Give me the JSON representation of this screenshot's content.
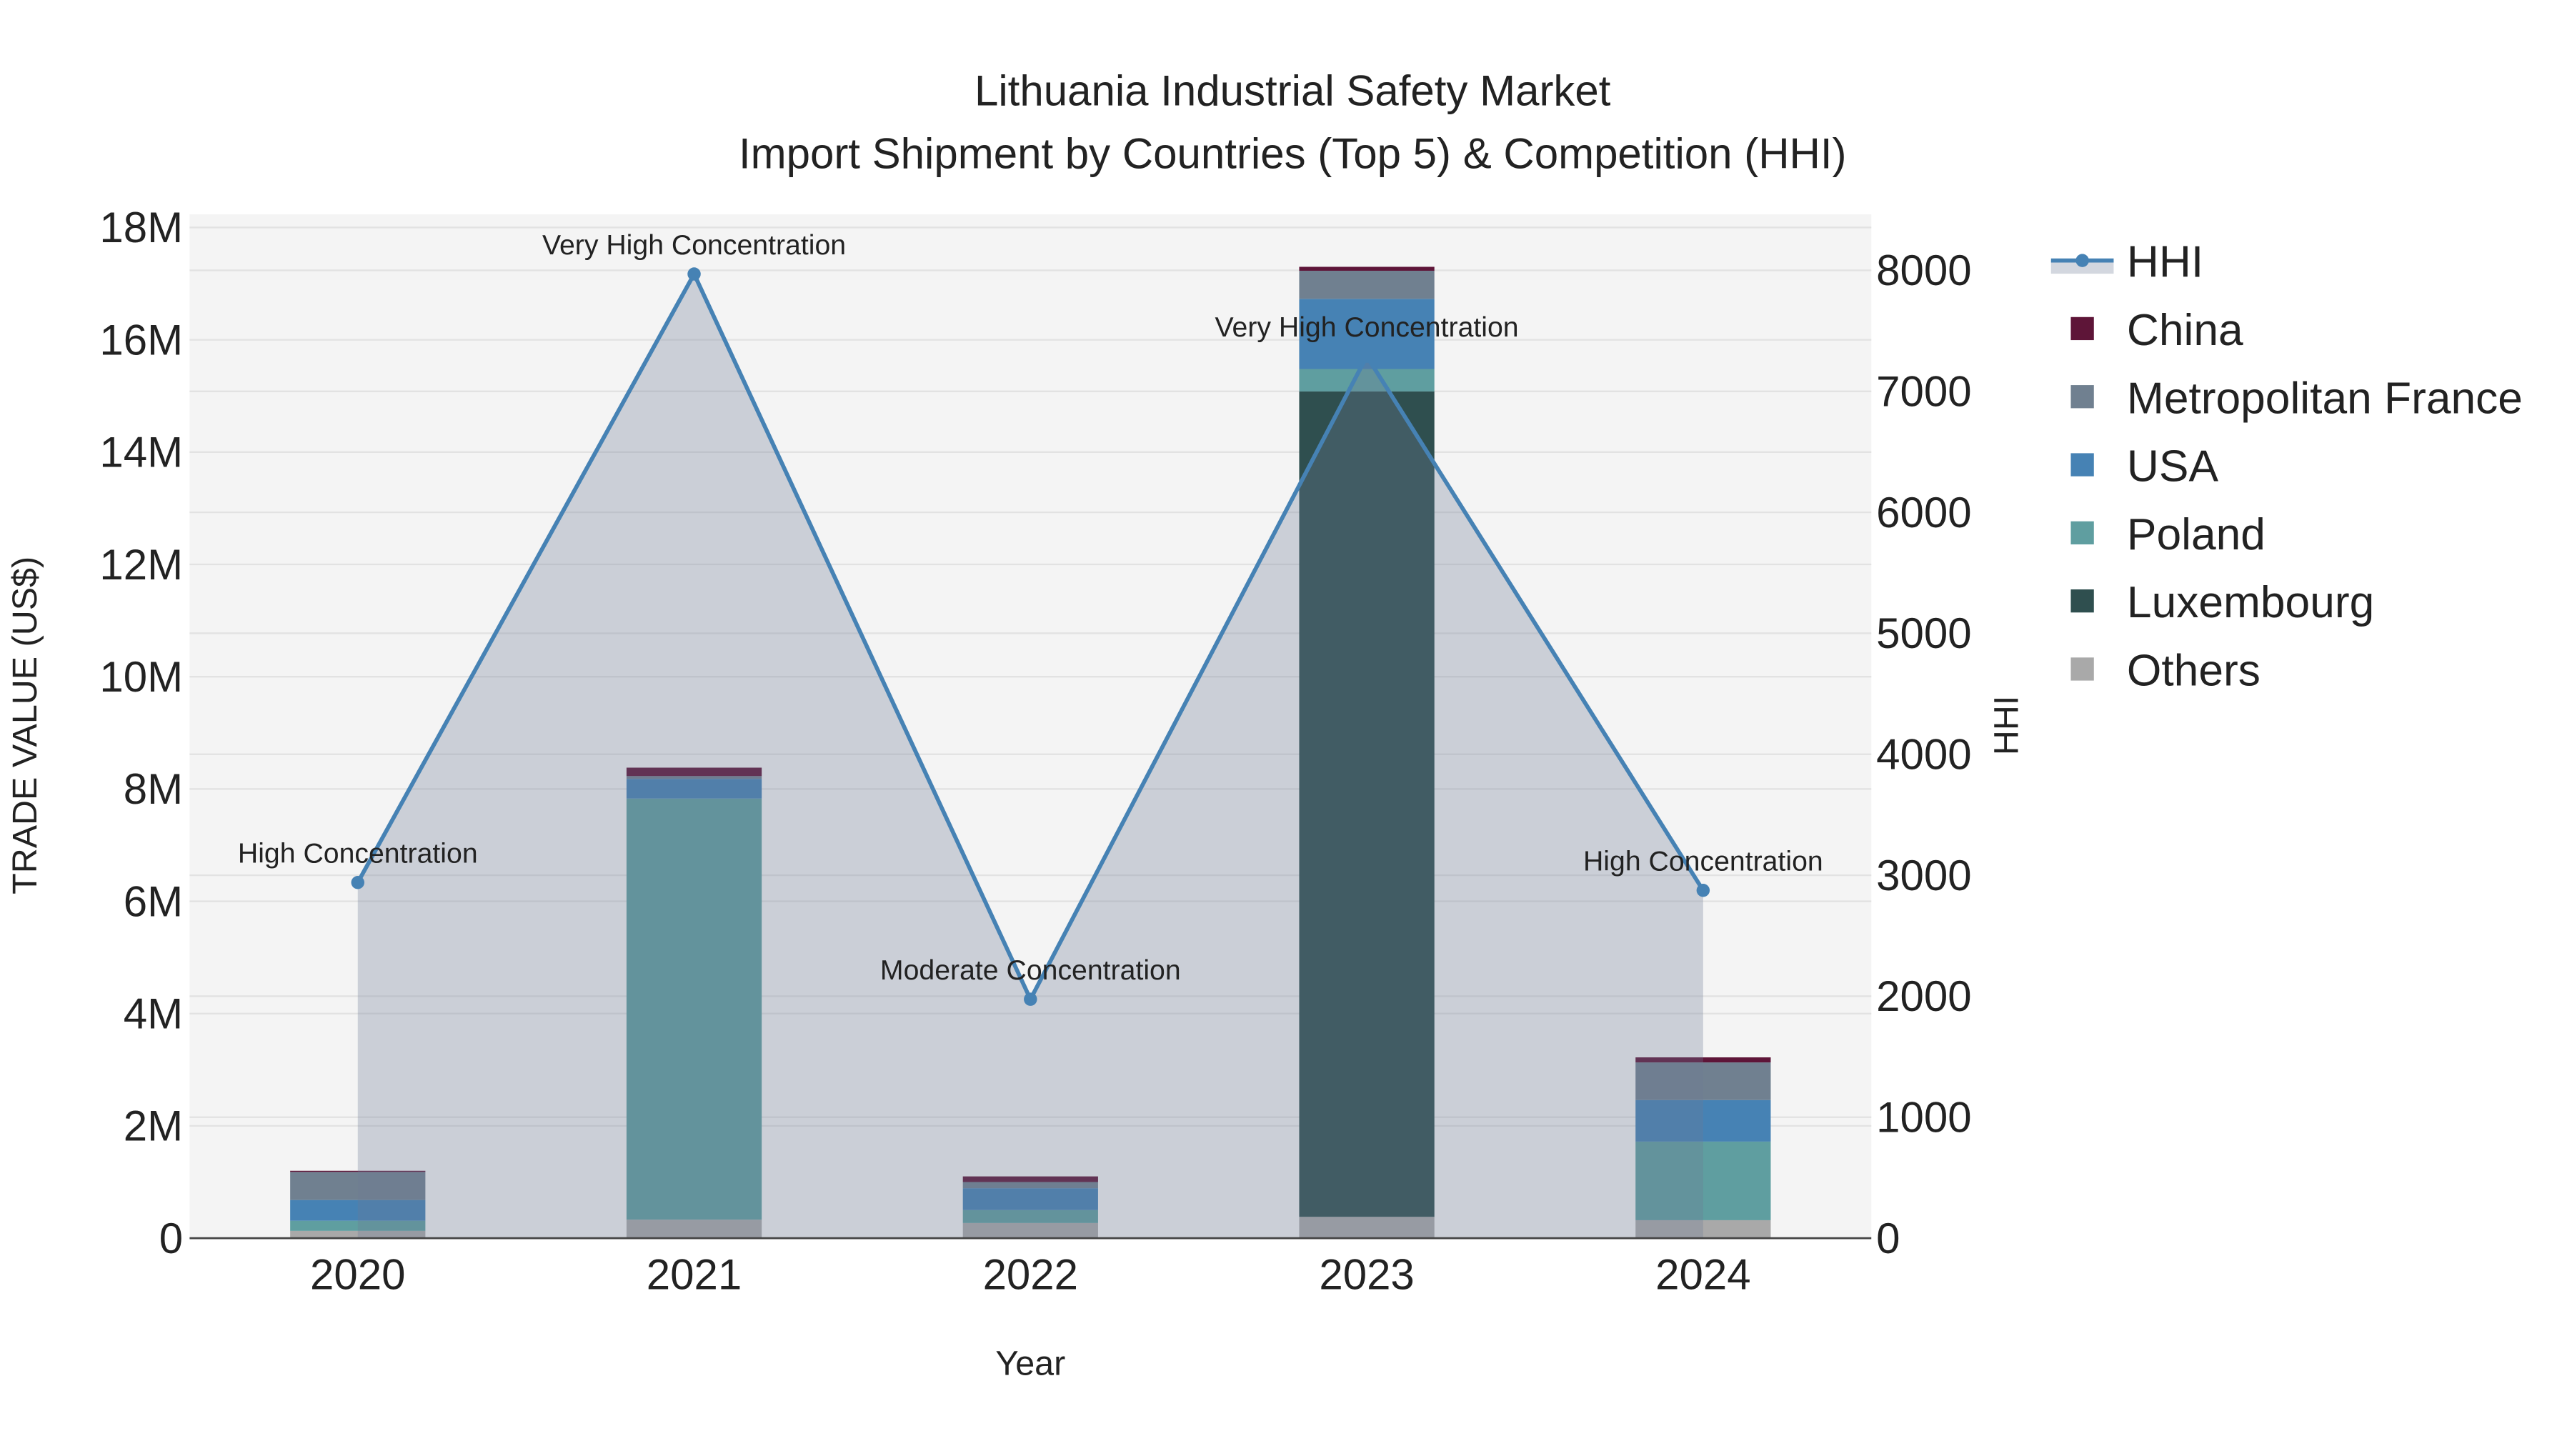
{
  "chart_data": {
    "type": "bar",
    "title": "Lithuania Industrial Safety Market",
    "subtitle": "Import Shipment by Countries (Top 5) & Competition (HHI)",
    "xlabel": "Year",
    "ylabel": "TRADE VALUE (US$)",
    "y2label": "HHI",
    "categories": [
      "2020",
      "2021",
      "2022",
      "2023",
      "2024"
    ],
    "ylim": [
      0,
      18000000
    ],
    "y_ticks": [
      0,
      2000000,
      4000000,
      6000000,
      8000000,
      10000000,
      12000000,
      14000000,
      16000000,
      18000000
    ],
    "y_tick_labels": [
      "0",
      "2M",
      "4M",
      "6M",
      "8M",
      "10M",
      "12M",
      "14M",
      "16M",
      "18M"
    ],
    "y2lim": [
      0,
      8450
    ],
    "y2_ticks": [
      0,
      1000,
      2000,
      3000,
      4000,
      5000,
      6000,
      7000,
      8000
    ],
    "y2_tick_labels": [
      "0",
      "1000",
      "2000",
      "3000",
      "4000",
      "5000",
      "6000",
      "7000",
      "8000"
    ],
    "grid": true,
    "legend_position": "right",
    "stack_order": [
      "Others",
      "Luxembourg",
      "Poland",
      "USA",
      "Metropolitan France",
      "China"
    ],
    "series": [
      {
        "name": "China",
        "color": "#5e1538",
        "values": [
          20000,
          150000,
          100000,
          70000,
          90000
        ]
      },
      {
        "name": "Metropolitan France",
        "color": "#708090",
        "values": [
          500000,
          50000,
          110000,
          500000,
          670000
        ]
      },
      {
        "name": "USA",
        "color": "#4682b4",
        "values": [
          370000,
          350000,
          390000,
          1250000,
          740000
        ]
      },
      {
        "name": "Poland",
        "color": "#5f9ea0",
        "values": [
          180000,
          7500000,
          230000,
          400000,
          1400000
        ]
      },
      {
        "name": "Luxembourg",
        "color": "#2f4f4f",
        "values": [
          0,
          0,
          0,
          14700000,
          0
        ]
      },
      {
        "name": "Others",
        "color": "#a9a9a9",
        "values": [
          130000,
          330000,
          270000,
          380000,
          320000
        ]
      }
    ],
    "hhi": {
      "name": "HHI",
      "color": "#4682b4",
      "values": [
        2940,
        7970,
        1975,
        7290,
        2875
      ],
      "annotations": [
        "High Concentration",
        "Very High Concentration",
        "Moderate Concentration",
        "Very High Concentration",
        "High Concentration"
      ]
    }
  }
}
